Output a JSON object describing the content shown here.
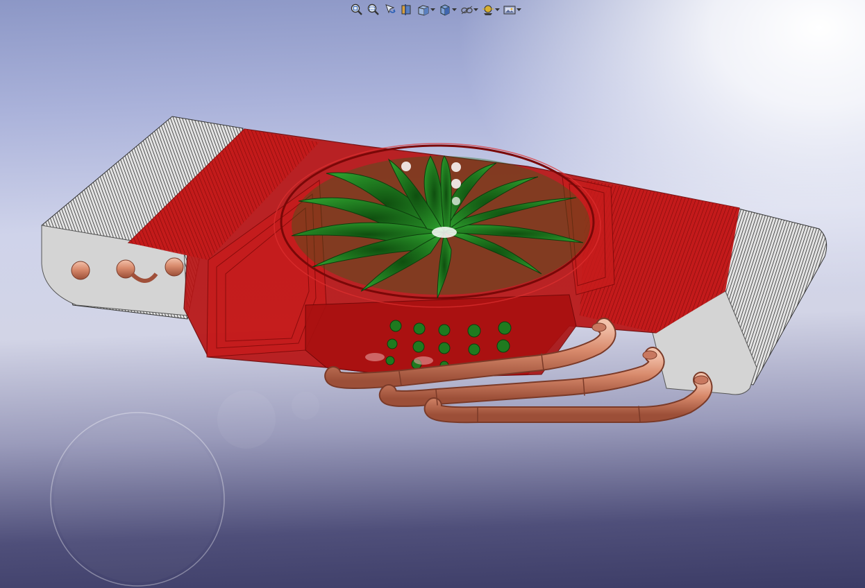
{
  "app": {
    "name": "CAD 3D viewport"
  },
  "heads_up_toolbar": {
    "buttons": [
      {
        "id": "zoom-to-fit",
        "icon": "zoom-to-fit-icon",
        "has_dropdown": false
      },
      {
        "id": "zoom-to-area",
        "icon": "zoom-to-area-icon",
        "has_dropdown": false
      },
      {
        "id": "previous-view",
        "icon": "previous-view-icon",
        "has_dropdown": false
      },
      {
        "id": "section-view",
        "icon": "section-view-icon",
        "has_dropdown": false
      },
      {
        "id": "view-orientation",
        "icon": "view-orientation-icon",
        "has_dropdown": true
      },
      {
        "id": "display-style",
        "icon": "display-style-icon",
        "has_dropdown": true
      },
      {
        "id": "hide-show-items",
        "icon": "hide-show-items-icon",
        "has_dropdown": true
      },
      {
        "id": "edit-appearance",
        "icon": "edit-appearance-icon",
        "has_dropdown": true
      },
      {
        "id": "apply-scene",
        "icon": "apply-scene-icon",
        "has_dropdown": true
      }
    ]
  },
  "model": {
    "description_visible": false,
    "colors": {
      "shroud": "#c41414",
      "shroud_dark": "#8e0b0b",
      "fan_blades": "#1f7a1f",
      "fin_grey": "#c8c8c8",
      "fin_lines": "#2a2a2a",
      "heat_pipes": "#c87860",
      "heat_pipe_highlight": "#f0b9a2"
    }
  },
  "background": {
    "top_color": "#8c97c6",
    "mid_color": "#d2d4e6",
    "bottom_color": "#3c3c66"
  }
}
